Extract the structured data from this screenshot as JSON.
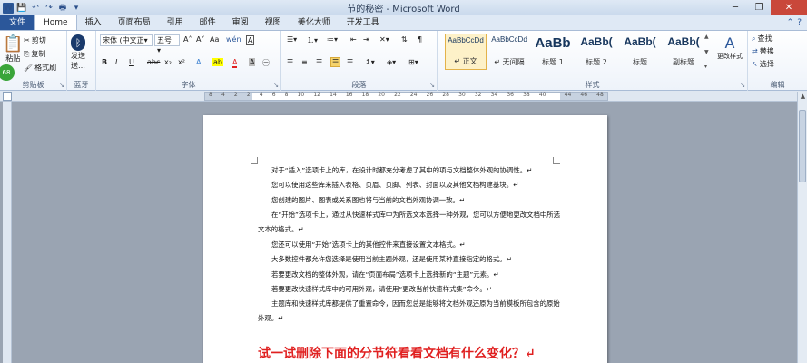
{
  "window": {
    "title": "节的秘密 - Microsoft Word",
    "word_logo": "W",
    "minimize": "─",
    "restore": "❐",
    "close": "✕"
  },
  "tabs": [
    {
      "label": "文件"
    },
    {
      "label": "Home"
    },
    {
      "label": "插入"
    },
    {
      "label": "页面布局"
    },
    {
      "label": "引用"
    },
    {
      "label": "邮件"
    },
    {
      "label": "审阅"
    },
    {
      "label": "视图"
    },
    {
      "label": "美化大师"
    },
    {
      "label": "开发工具"
    }
  ],
  "ribbon": {
    "clipboard": {
      "label": "剪贴板",
      "paste": "粘贴",
      "cut": "剪切",
      "copy": "复制",
      "format_painter": "格式刷",
      "badge": "68"
    },
    "send": {
      "label": "蓝牙",
      "send": "发送"
    },
    "font": {
      "label": "字体",
      "font_name": "宋体 (中文正▾",
      "font_size": "五号 ▾",
      "bold": "B",
      "italic": "I",
      "underline": "U",
      "strike": "abc",
      "subscript": "x₂",
      "superscript": "x²",
      "grow": "A˄",
      "shrink": "A˅",
      "clear": "Aa",
      "pinyin": "wén",
      "border_char": "A",
      "text_effect": "A",
      "highlight": "ab",
      "font_color": "A",
      "char_shade": "A",
      "enclose": "㊀"
    },
    "paragraph": {
      "label": "段落"
    },
    "styles": {
      "label": "样式",
      "items": [
        {
          "sample": "AaBbCcDd",
          "name": "正文",
          "prefix": "↵"
        },
        {
          "sample": "AaBbCcDd",
          "name": "无间隔",
          "prefix": "↵"
        },
        {
          "sample": "AaBb",
          "name": "标题 1",
          "prefix": ""
        },
        {
          "sample": "AaBb(",
          "name": "标题 2",
          "prefix": ""
        },
        {
          "sample": "AaBb(",
          "name": "标题",
          "prefix": ""
        },
        {
          "sample": "AaBb(",
          "name": "副标题",
          "prefix": ""
        }
      ],
      "change_styles": "更改样式"
    },
    "editing": {
      "label": "编辑",
      "find": "查找",
      "replace": "替换",
      "select": "选择"
    }
  },
  "ruler": {
    "numbers": [
      "8",
      "4",
      "2",
      "2",
      "4",
      "6",
      "8",
      "10",
      "12",
      "14",
      "16",
      "18",
      "20",
      "22",
      "24",
      "26",
      "28",
      "30",
      "32",
      "34",
      "36",
      "38",
      "40",
      "",
      "44",
      "46",
      "48"
    ]
  },
  "document": {
    "paragraphs": [
      "对于“插入”选项卡上的库，在设计时都充分考虑了其中的项与文档整体外观的协调性。↵",
      "您可以使用这些库来插入表格、页眉、页脚、列表、封面以及其他文档构建基块。↵",
      "您创建的图片、图表或关系图也将与当前的文档外观协调一致。↵",
      "在“开始”选项卡上，通过从快速样式库中为所选文本选择一种外观，您可以方便地更改文档中所选文本的格式。↵",
      "您还可以使用“开始”选项卡上的其他控件来直接设置文本格式。↵",
      "大多数控件都允许您选择是使用当前主题外观，还是使用某种直接指定的格式。↵",
      "若要更改文档的整体外观，请在“页面布局”选项卡上选择新的“主题”元素。↵",
      "若要更改快速样式库中的可用外观，请使用“更改当前快速样式集”命令。↵",
      "主题库和快速样式库都提供了重置命令，因而您总是能够将文档外观还原为当前模板所包含的原始外观。↵"
    ],
    "heading": "试一试删除下面的分节符看看文档有什么变化？↵"
  },
  "colors": {
    "file_tab": "#2b579a",
    "heading_red": "#e02020",
    "highlight_yellow": "#ffff00",
    "font_red": "#e02020"
  }
}
